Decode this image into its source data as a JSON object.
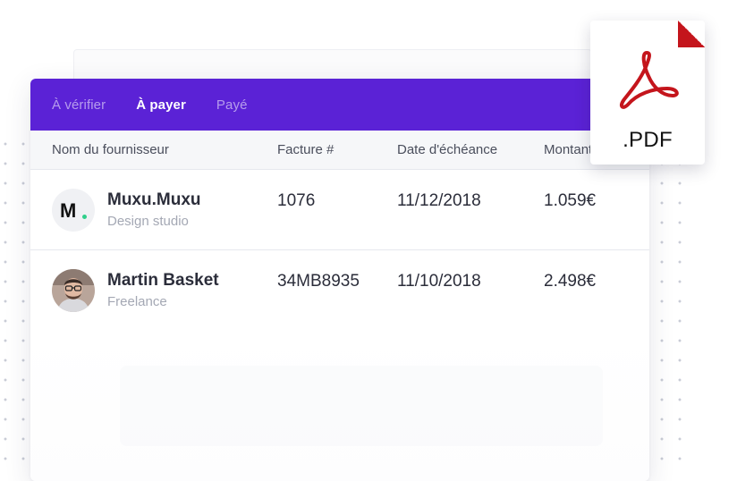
{
  "tabs": [
    {
      "label": "À vérifier",
      "active": false
    },
    {
      "label": "À payer",
      "active": true
    },
    {
      "label": "Payé",
      "active": false
    }
  ],
  "table": {
    "headers": [
      "Nom du fournisseur",
      "Facture #",
      "Date d'échéance",
      "Montant"
    ],
    "rows": [
      {
        "avatar_type": "logo",
        "avatar_text": "M",
        "name": "Muxu.Muxu",
        "sub": "Design studio",
        "invoice": "1076",
        "due_date": "11/12/2018",
        "amount": "1.059€"
      },
      {
        "avatar_type": "photo",
        "name": "Martin Basket",
        "sub": "Freelance",
        "invoice": "34MB8935",
        "due_date": "11/10/2018",
        "amount": "2.498€"
      }
    ]
  },
  "pdf_badge": {
    "label": ".PDF",
    "icon": "acrobat-pdf-icon"
  },
  "colors": {
    "accent": "#5b22d6",
    "pdf_red": "#c4151c",
    "logo_dot": "#2fcf8a"
  }
}
